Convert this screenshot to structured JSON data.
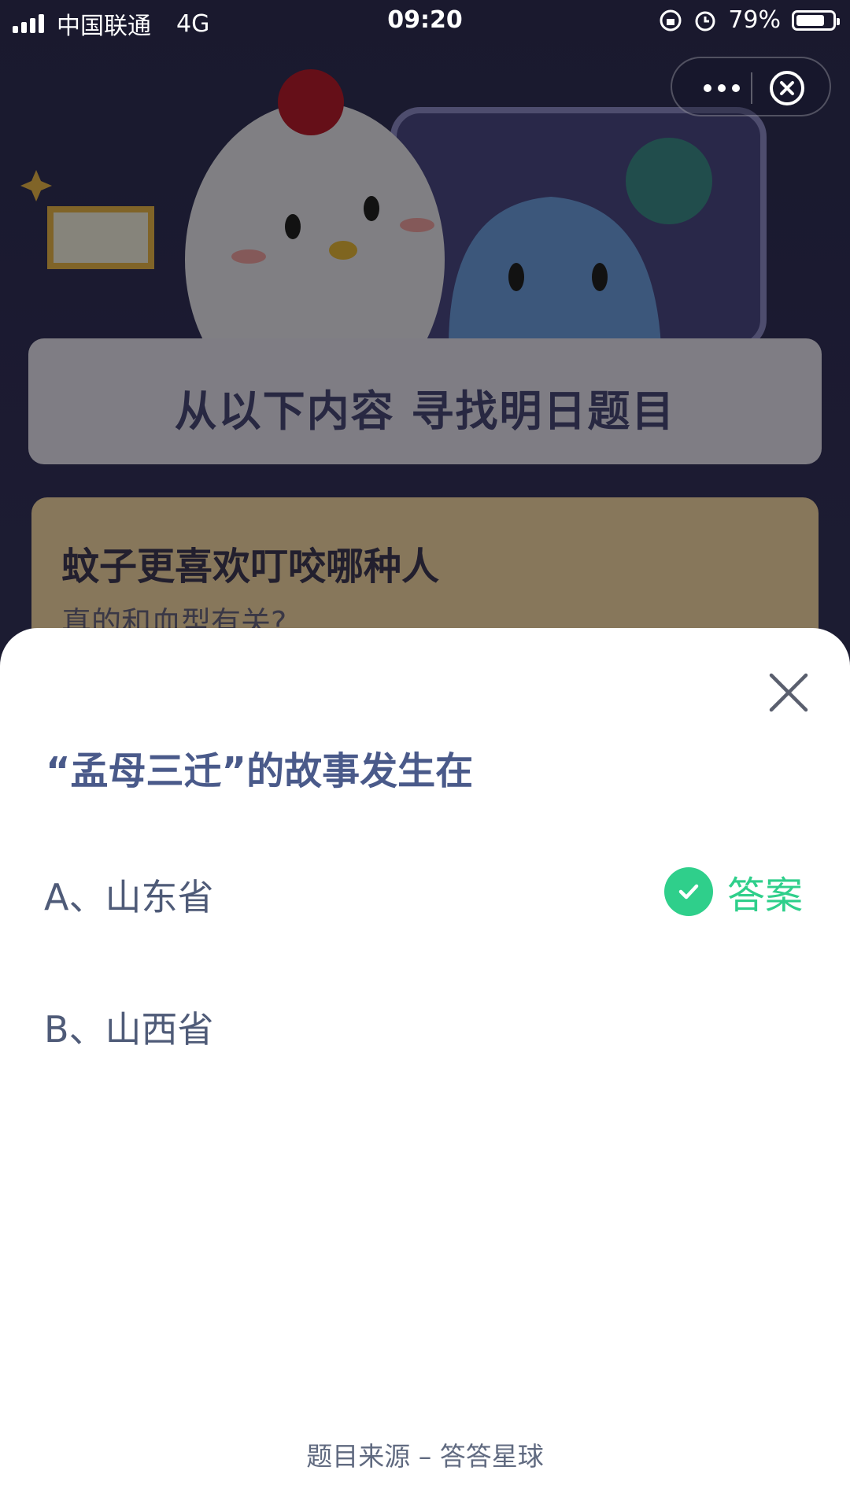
{
  "status_bar": {
    "carrier": "中国联通",
    "network": "4G",
    "time": "09:20",
    "battery_percent": "79%",
    "battery_level": 0.79
  },
  "capsule": {
    "more_icon": "more-dots-icon",
    "close_icon": "close-circle-icon"
  },
  "background": {
    "banner_title": "从以下内容  寻找明日题目",
    "teaser_title": "蚊子更喜欢叮咬哪种人",
    "teaser_subtitle": "真的和血型有关?"
  },
  "sheet": {
    "close_icon": "close-icon",
    "question": "“孟母三迁”的故事发生在",
    "options": [
      {
        "label": "A、山东省",
        "is_answer": true
      },
      {
        "label": "B、山西省",
        "is_answer": false
      }
    ],
    "answer_label": "答案",
    "answer_color": "#2fcf8b",
    "source": "题目来源 – 答答星球"
  }
}
